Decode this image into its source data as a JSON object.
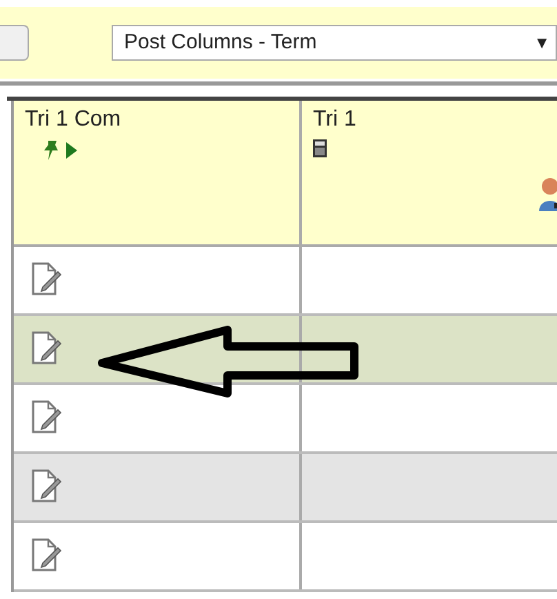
{
  "toolbar": {
    "dropdown": {
      "value": "Post Columns - Term",
      "arrow": "▼"
    }
  },
  "table": {
    "columns": [
      {
        "label": "Tri 1 Com",
        "kind": "comment"
      },
      {
        "label": "Tri 1",
        "kind": "calculated"
      }
    ],
    "rows": [
      {
        "selected": false,
        "shaded": false
      },
      {
        "selected": true,
        "shaded": false
      },
      {
        "selected": false,
        "shaded": false
      },
      {
        "selected": false,
        "shaded": true
      },
      {
        "selected": false,
        "shaded": false
      }
    ]
  }
}
